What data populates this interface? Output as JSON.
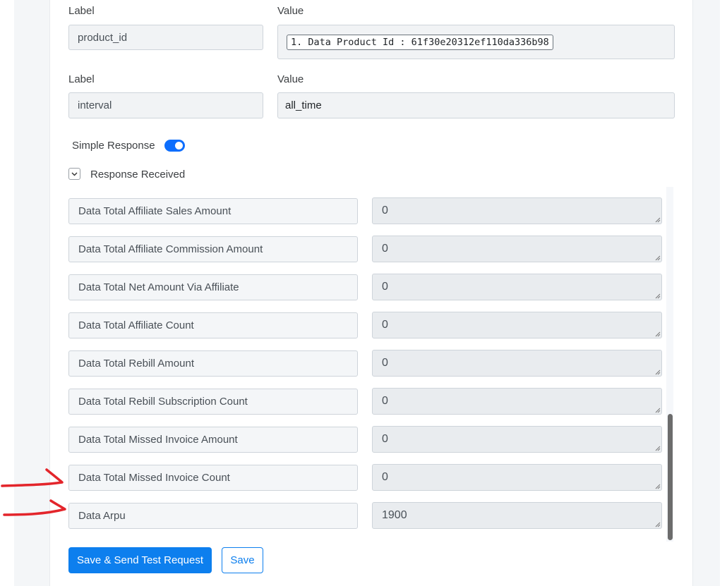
{
  "params": [
    {
      "label_header": "Label",
      "value_header": "Value",
      "label": "product_id",
      "value": "1. Data Product Id : 61f30e20312ef110da336b98"
    },
    {
      "label_header": "Label",
      "value_header": "Value",
      "label": "interval",
      "value": "all_time"
    }
  ],
  "simple_response": {
    "label": "Simple Response",
    "enabled": true
  },
  "response_received": {
    "label": "Response Received",
    "expanded": true
  },
  "response_fields": [
    {
      "key": "Data Total Affiliate Sales Amount",
      "value": "0"
    },
    {
      "key": "Data Total Affiliate Commission Amount",
      "value": "0"
    },
    {
      "key": "Data Total Net Amount Via Affiliate",
      "value": "0"
    },
    {
      "key": "Data Total Affiliate Count",
      "value": "0"
    },
    {
      "key": "Data Total Rebill Amount",
      "value": "0"
    },
    {
      "key": "Data Total Rebill Subscription Count",
      "value": "0"
    },
    {
      "key": "Data Total Missed Invoice Amount",
      "value": "0"
    },
    {
      "key": "Data Total Missed Invoice Count",
      "value": "0"
    },
    {
      "key": "Data Arpu",
      "value": "1900"
    }
  ],
  "buttons": {
    "save_send": "Save & Send Test Request",
    "save": "Save"
  },
  "colors": {
    "primary": "#0d7fee",
    "annotation": "#e3252b"
  }
}
